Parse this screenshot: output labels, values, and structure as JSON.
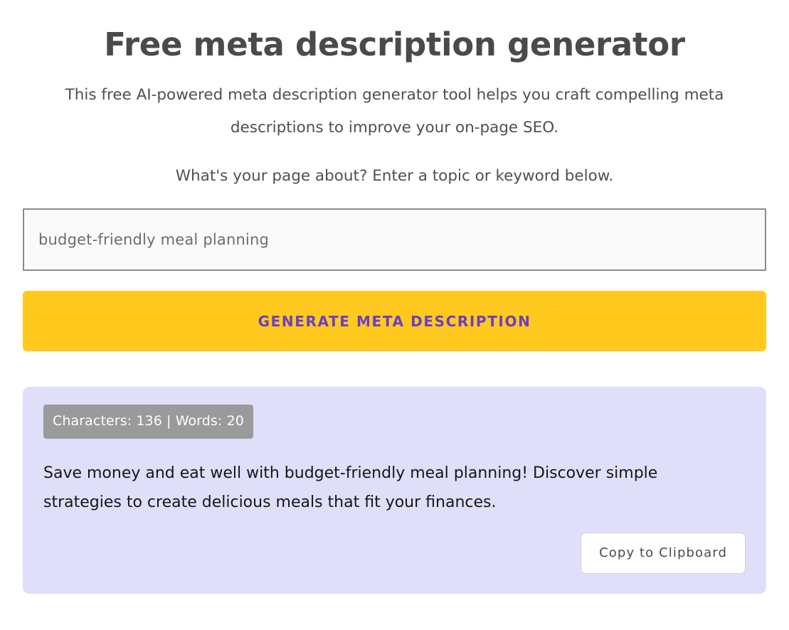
{
  "header": {
    "title": "Free meta description generator"
  },
  "intro": {
    "line1": "This free AI-powered meta description generator tool helps you craft compelling meta",
    "line2": "descriptions to improve your on-page SEO.",
    "prompt": "What's your page about? Enter a topic or keyword below."
  },
  "form": {
    "topic_value": "budget-friendly meal planning",
    "topic_placeholder": "budget-friendly meal planning",
    "generate_label": "Generate meta description"
  },
  "result": {
    "stats": "Characters: 136 | Words: 20",
    "characters": 136,
    "words": 20,
    "text": "Save money and eat well with budget-friendly meal planning! Discover simple strategies to create delicious meals that fit your finances.",
    "copy_label": "Copy to Clipboard"
  },
  "colors": {
    "accent_yellow": "#ffc91e",
    "accent_purple": "#6b3fc4",
    "panel_lavender": "#dfdffa",
    "badge_gray": "#9a9a9a",
    "title_gray": "#4a4a4a"
  }
}
